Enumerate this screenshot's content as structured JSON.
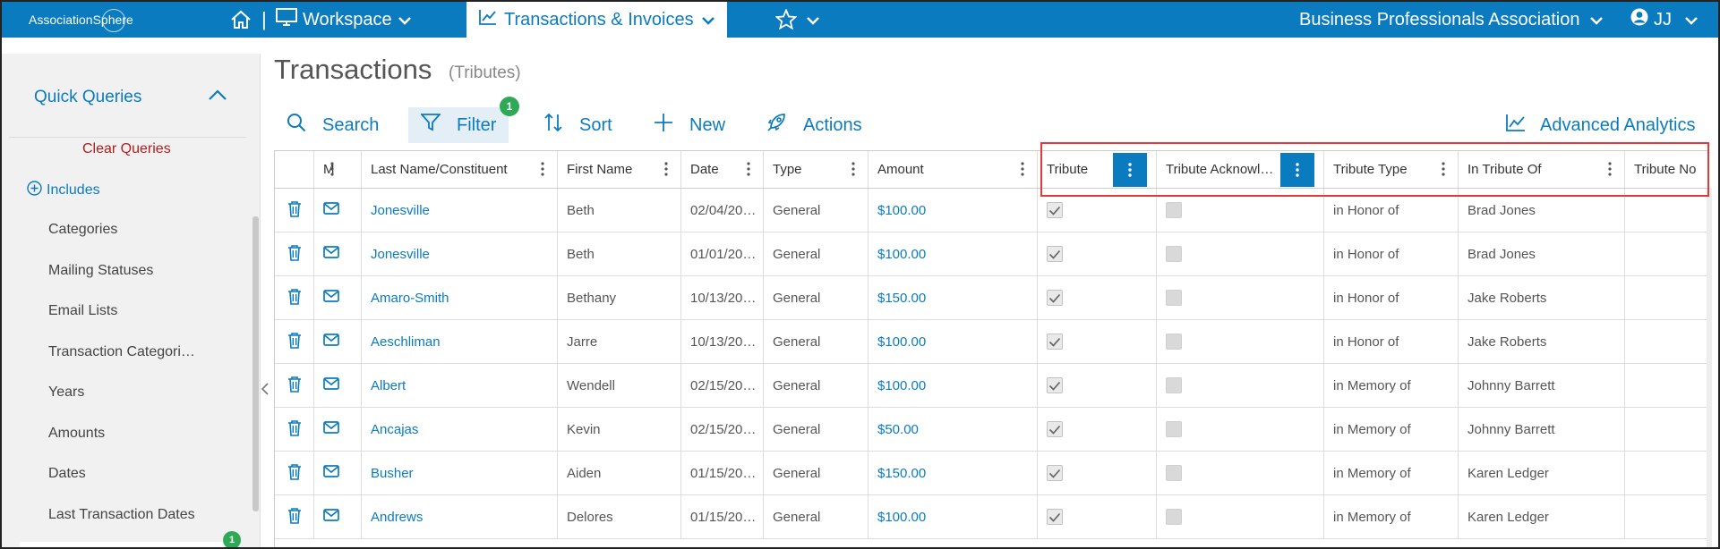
{
  "topbar": {
    "logo_text_1": "Association",
    "logo_text_2": "Sphere",
    "separator": "|",
    "workspace_label": "Workspace",
    "active_tab_label": "Transactions & Invoices",
    "org_name": "Business Professionals Association",
    "user_initials": "JJ"
  },
  "sidebar": {
    "quick_queries": "Quick Queries",
    "clear_queries": "Clear Queries",
    "includes": "Includes",
    "items": [
      "Categories",
      "Mailing Statuses",
      "Email Lists",
      "Transaction Categori…",
      "Years",
      "Amounts",
      "Dates",
      "Last Transaction Dates"
    ],
    "badge_count": "1"
  },
  "page": {
    "title": "Transactions",
    "subtitle": "(Tributes)"
  },
  "toolbar": {
    "search": "Search",
    "filter": "Filter",
    "filter_count": "1",
    "sort": "Sort",
    "new": "New",
    "actions": "Actions",
    "advanced_analytics": "Advanced Analytics"
  },
  "grid": {
    "columns": [
      "M",
      "Last Name/Constituent",
      "First Name",
      "Date",
      "Type",
      "Amount",
      "Tribute",
      "Tribute Acknowl…",
      "Tribute Type",
      "In Tribute Of",
      "Tribute No"
    ],
    "rows": [
      {
        "last": "Jonesville",
        "first": "Beth",
        "date": "02/04/20…",
        "type": "General",
        "amount": "$100.00",
        "tribute": true,
        "ack": false,
        "ttype": "in Honor of",
        "of": "Brad Jones"
      },
      {
        "last": "Jonesville",
        "first": "Beth",
        "date": "01/01/20…",
        "type": "General",
        "amount": "$100.00",
        "tribute": true,
        "ack": false,
        "ttype": "in Honor of",
        "of": "Brad Jones"
      },
      {
        "last": "Amaro-Smith",
        "first": "Bethany",
        "date": "10/13/20…",
        "type": "General",
        "amount": "$150.00",
        "tribute": true,
        "ack": false,
        "ttype": "in Honor of",
        "of": "Jake Roberts"
      },
      {
        "last": "Aeschliman",
        "first": "Jarre",
        "date": "10/13/20…",
        "type": "General",
        "amount": "$100.00",
        "tribute": true,
        "ack": false,
        "ttype": "in Honor of",
        "of": "Jake Roberts"
      },
      {
        "last": "Albert",
        "first": "Wendell",
        "date": "02/15/20…",
        "type": "General",
        "amount": "$100.00",
        "tribute": true,
        "ack": false,
        "ttype": "in Memory of",
        "of": "Johnny Barrett"
      },
      {
        "last": "Ancajas",
        "first": "Kevin",
        "date": "02/15/20…",
        "type": "General",
        "amount": "$50.00",
        "tribute": true,
        "ack": false,
        "ttype": "in Memory of",
        "of": "Johnny Barrett"
      },
      {
        "last": "Busher",
        "first": "Aiden",
        "date": "01/15/20…",
        "type": "General",
        "amount": "$150.00",
        "tribute": true,
        "ack": false,
        "ttype": "in Memory of",
        "of": "Karen Ledger"
      },
      {
        "last": "Andrews",
        "first": "Delores",
        "date": "01/15/20…",
        "type": "General",
        "amount": "$100.00",
        "tribute": true,
        "ack": false,
        "ttype": "in Memory of",
        "of": "Karen Ledger"
      }
    ]
  },
  "colors": {
    "brand": "#0b7bc0",
    "highlight": "#e2393b",
    "badge": "#2eaa57",
    "danger_text": "#b01e1e"
  }
}
